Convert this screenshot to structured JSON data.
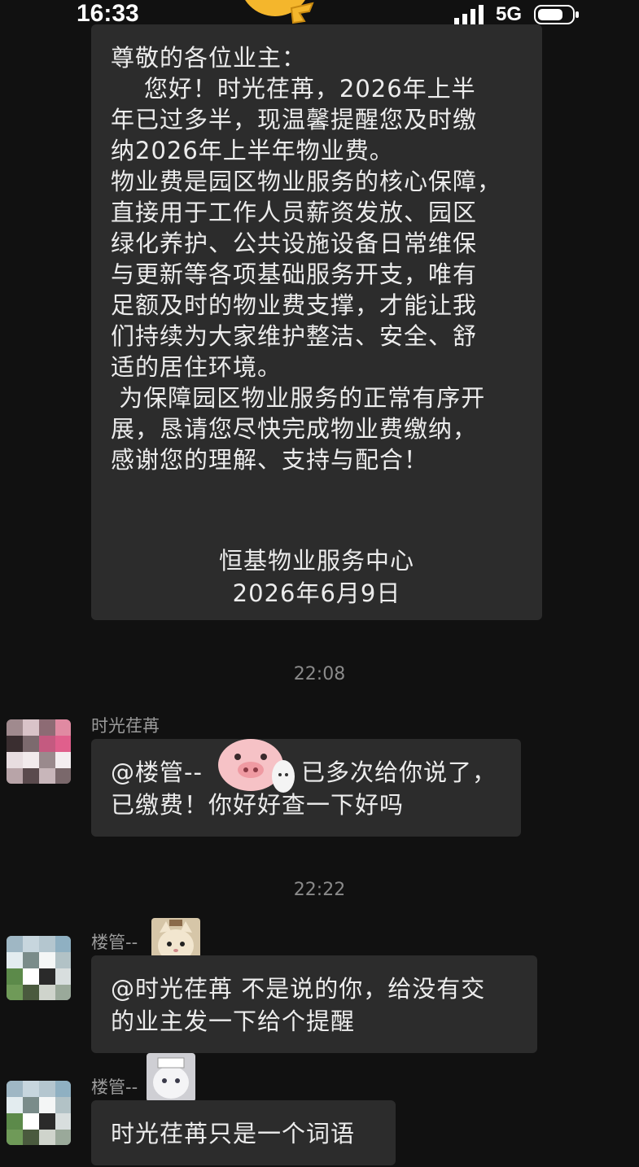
{
  "status_bar": {
    "time": "16:33",
    "network": "5G",
    "icons": [
      "emoji-icon",
      "signal-icon",
      "battery-icon"
    ]
  },
  "notice": {
    "lines": [
      "尊敬的各位业主：",
      "    您好！时光荏苒，2026年上半",
      "年已过多半，现温馨提醒您及时缴",
      "纳2026年上半年物业费。",
      "物业费是园区物业服务的核心保障，",
      "直接用于工作人员薪资发放、园区",
      "绿化养护、公共设施设备日常维保",
      "与更新等各项基础服务开支，唯有",
      "足额及时的物业费支撑，才能让我",
      "们持续为大家维护整洁、安全、舒",
      "适的居住环境。",
      " 为保障园区物业服务的正常有序开",
      "展，恳请您尽快完成物业费缴纳，",
      "感谢您的理解、支持与配合！"
    ],
    "signature": "恒基物业服务中心",
    "date": "2026年6月9日"
  },
  "timestamps": [
    "22:08",
    "22:22"
  ],
  "messages": [
    {
      "sender": "时光荏苒",
      "text_line1_prefix": "@楼管--",
      "text_line1_suffix": "已多次给你说了，",
      "text_line2": "已缴费！你好好查一下好吗"
    },
    {
      "sender": "楼管--",
      "text_line1": "@时光荏苒 不是说的你，给没有交",
      "text_line2": "的业主发一下给个提醒"
    },
    {
      "sender": "楼管--",
      "text_line1": "时光荏苒只是一个词语"
    }
  ],
  "colors": {
    "background": "#111111",
    "bubble": "#2c2c2c",
    "text": "#ececec",
    "timestamp": "#8a8a8a"
  }
}
